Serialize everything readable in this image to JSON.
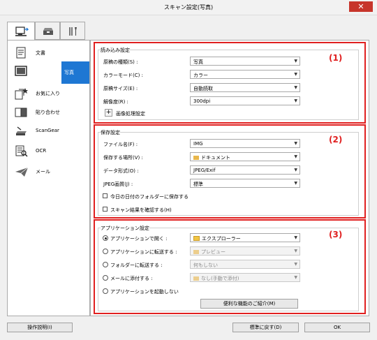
{
  "window": {
    "title": "スキャン設定(写真)",
    "close_glyph": "✕"
  },
  "tabs": [
    {
      "name": "scan-from-computer-tab-icon"
    },
    {
      "name": "scanner-button-tab-icon"
    },
    {
      "name": "general-settings-tab-icon"
    }
  ],
  "sidebar": {
    "items": [
      {
        "label": "文書",
        "icon": "document-icon"
      },
      {
        "label": "写真",
        "icon": "photo-icon",
        "active": true
      },
      {
        "label": "お気に入り",
        "icon": "favorites-icon"
      },
      {
        "label": "貼り合わせ",
        "icon": "stitch-icon"
      },
      {
        "label": "ScanGear",
        "icon": "scangear-icon"
      },
      {
        "label": "OCR",
        "icon": "ocr-icon"
      },
      {
        "label": "メール",
        "icon": "mail-icon"
      }
    ]
  },
  "scan_options": {
    "title": "読み込み設定",
    "number": "(1)",
    "rows": [
      {
        "label": "原稿の種類(S) :",
        "value": "写真"
      },
      {
        "label": "カラーモード(C) :",
        "value": "カラー"
      },
      {
        "label": "原稿サイズ(E) :",
        "value": "自動読取"
      },
      {
        "label": "解像度(R) :",
        "value": "300dpi"
      }
    ],
    "image_processing": "画像処理設定",
    "plus": "+"
  },
  "save_settings": {
    "title": "保存設定",
    "number": "(2)",
    "rows": [
      {
        "label": "ファイル名(F) :",
        "value": "IMG"
      },
      {
        "label": "保存する場所(V) :",
        "value": "ドキュメント"
      },
      {
        "label": "データ形式(O) :",
        "value": "JPEG/Exif"
      },
      {
        "label": "JPEG画質(J) :",
        "value": "標準"
      }
    ],
    "checkbox_date_folder": "今日の日付のフォルダーに保存する",
    "checkbox_check_result": "スキャン結果を確認する(H)"
  },
  "app_settings": {
    "title": "アプリケーション設定",
    "number": "(3)",
    "options": [
      {
        "label": "アプリケーションで開く :",
        "value": "エクスプローラー",
        "selected": true
      },
      {
        "label": "アプリケーションに転送する :",
        "value": "プレビュー",
        "selected": false
      },
      {
        "label": "フォルダーに転送する :",
        "value": "何もしない",
        "selected": false
      },
      {
        "label": "メールに添付する :",
        "value": "なし(手動で添付)",
        "selected": false
      },
      {
        "label": "アプリケーションを起動しない",
        "selected": false
      }
    ],
    "more_functions_button": "便利な機能のご紹介(M)"
  },
  "footer": {
    "instructions": "操作説明(I)",
    "defaults": "標準に戻す(D)",
    "ok": "OK"
  },
  "colors": {
    "highlight_red": "#e02020",
    "active_blue": "#1e77d3"
  }
}
